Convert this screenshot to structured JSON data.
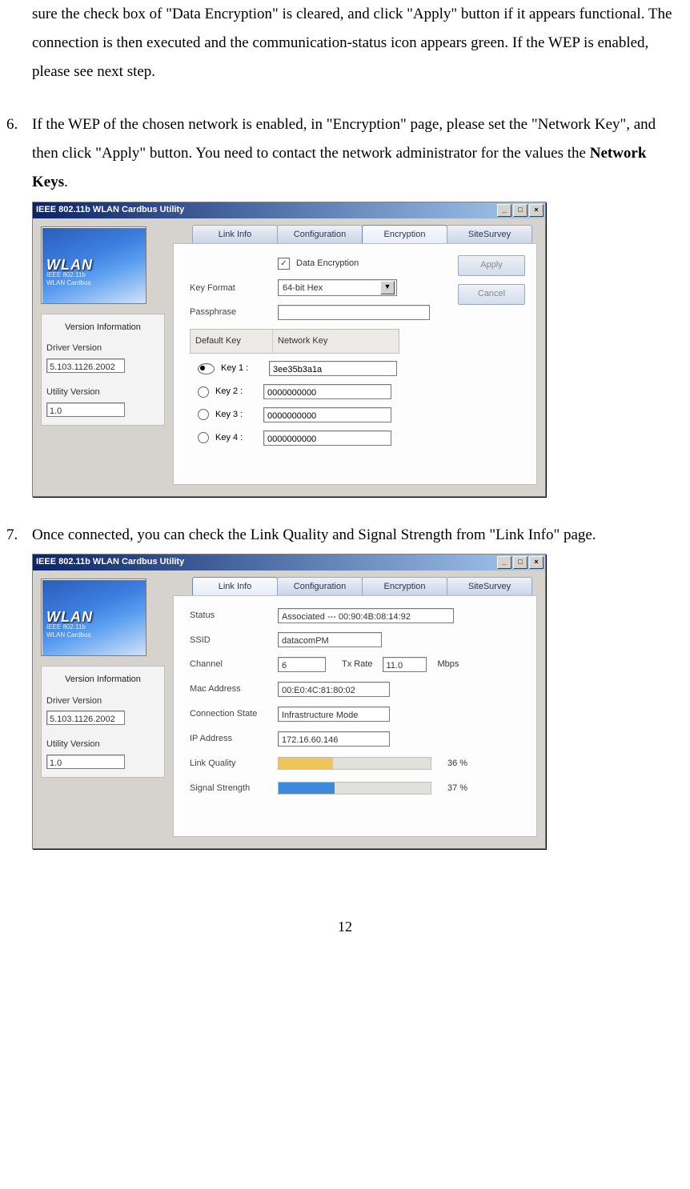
{
  "text": {
    "top_fragment": "sure the check box of \"Data Encryption\" is cleared, and click \"Apply\" button if it appears functional.    The connection is then executed and the communication-status icon appears green.    If the WEP is enabled, please see next step.",
    "item6_num": "6.",
    "item6_a": "If the WEP of the chosen network is enabled, in \"Encryption\" page, please set the \"Network Key\", and then click \"Apply\" button.    You need to contact the network administrator for the values the ",
    "item6_b": "Network Keys",
    "item6_c": ".",
    "item7_num": "7.",
    "item7": "Once connected, you can check the Link Quality and Signal Strength from \"Link Info\" page.",
    "page_num": "12"
  },
  "win": {
    "title": "IEEE 802.11b WLAN Cardbus Utility",
    "tabs": {
      "link": "Link Info",
      "config": "Configuration",
      "enc": "Encryption",
      "site": "SiteSurvey"
    },
    "wlan": {
      "big": "WLAN",
      "l1": "IEEE 802.11b",
      "l2": "WLAN Cardbus"
    },
    "version": {
      "title": "Version Information",
      "drv_lbl": "Driver Version",
      "drv_val": "5.103.1126.2002",
      "util_lbl": "Utility Version",
      "util_val": "1.0"
    },
    "buttons": {
      "apply": "Apply",
      "cancel": "Cancel"
    }
  },
  "enc": {
    "data_encryption": "Data Encryption",
    "key_format_lbl": "Key Format",
    "key_format_val": "64-bit Hex",
    "passphrase_lbl": "Passphrase",
    "passphrase_val": "",
    "hdr_default": "Default Key",
    "hdr_network": "Network Key",
    "k1_lbl": "Key 1 :",
    "k1_val": "3ee35b3a1a",
    "k2_lbl": "Key 2 :",
    "k2_val": "0000000000",
    "k3_lbl": "Key 3 :",
    "k3_val": "0000000000",
    "k4_lbl": "Key 4 :",
    "k4_val": "0000000000"
  },
  "link": {
    "status_lbl": "Status",
    "status_val": "Associated --- 00:90:4B:08:14:92",
    "ssid_lbl": "SSID",
    "ssid_val": "datacomPM",
    "channel_lbl": "Channel",
    "channel_val": "6",
    "txrate_lbl": "Tx Rate",
    "txrate_val": "11.0",
    "mbps": "Mbps",
    "mac_lbl": "Mac Address",
    "mac_val": "00:E0:4C:81:80:02",
    "conn_lbl": "Connection State",
    "conn_val": "Infrastructure Mode",
    "ip_lbl": "IP Address",
    "ip_val": "172.16.60.146",
    "lq_lbl": "Link Quality",
    "lq_pct": "36 %",
    "ss_lbl": "Signal Strength",
    "ss_pct": "37 %"
  },
  "chart_data": [
    {
      "type": "bar",
      "title": "Link Quality",
      "categories": [
        "Link Quality"
      ],
      "values": [
        36
      ],
      "ylim": [
        0,
        100
      ],
      "color": "#edc55a"
    },
    {
      "type": "bar",
      "title": "Signal Strength",
      "categories": [
        "Signal Strength"
      ],
      "values": [
        37
      ],
      "ylim": [
        0,
        100
      ],
      "color": "#3d8bd8"
    }
  ]
}
